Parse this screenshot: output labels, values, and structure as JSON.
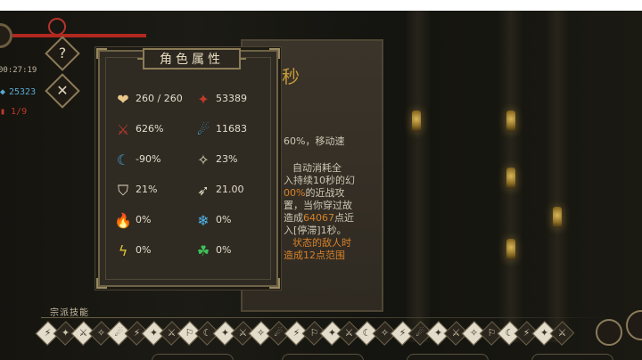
{
  "hud": {
    "timer": "00:27:19",
    "currency": "25323",
    "counter": "1/9",
    "help_glyph": "?",
    "close_glyph": "✕"
  },
  "attributes_panel": {
    "title": "角色属性",
    "stats": [
      {
        "icon": "heart-icon",
        "glyph": "❤",
        "color": "#e8c98a",
        "value": "260 / 260"
      },
      {
        "icon": "red-blade-icon",
        "glyph": "✦",
        "color": "#c0392b",
        "value": "53389"
      },
      {
        "icon": "red-claw-icon",
        "glyph": "⚔",
        "color": "#c0392b",
        "value": "626%"
      },
      {
        "icon": "blue-scythe-icon",
        "glyph": "☄",
        "color": "#3fa7d6",
        "value": "11683"
      },
      {
        "icon": "blue-crescent-icon",
        "glyph": "☾",
        "color": "#3fa7d6",
        "value": "-90%"
      },
      {
        "icon": "torn-scroll-icon",
        "glyph": "✧",
        "color": "#e8dcc0",
        "value": "23%"
      },
      {
        "icon": "shield-icon",
        "glyph": "⛉",
        "color": "#e8dcc0",
        "value": "21%"
      },
      {
        "icon": "boot-icon",
        "glyph": "➶",
        "color": "#e8dcc0",
        "value": "21.00"
      },
      {
        "icon": "fire-icon",
        "glyph": "🔥",
        "color": "#e06a1f",
        "value": "0%"
      },
      {
        "icon": "frost-icon",
        "glyph": "❄",
        "color": "#4fb3e8",
        "value": "0%"
      },
      {
        "icon": "lightning-icon",
        "glyph": "ϟ",
        "color": "#e0c13a",
        "value": "0%"
      },
      {
        "icon": "poison-icon",
        "glyph": "☘",
        "color": "#3ec25a",
        "value": "0%"
      }
    ]
  },
  "skill_description": {
    "title_glyph": "秒",
    "lines": [
      [
        {
          "t": "60%，移动速",
          "c": ""
        }
      ],
      [
        {
          "t": "自动消耗全",
          "c": ""
        }
      ],
      [
        {
          "t": "入持续10秒的幻",
          "c": ""
        }
      ],
      [
        {
          "t": "00%",
          "c": "orange"
        },
        {
          "t": "的近战攻",
          "c": ""
        }
      ],
      [
        {
          "t": "置，当你穿过故",
          "c": ""
        }
      ],
      [
        {
          "t": "造成",
          "c": ""
        },
        {
          "t": "64067",
          "c": "orange"
        },
        {
          "t": "点近",
          "c": ""
        }
      ],
      [
        {
          "t": "入[停滞]1秒。",
          "c": ""
        }
      ],
      [
        {
          "t": "状态的敌人时",
          "c": "orange"
        }
      ],
      [
        {
          "t": "造成12点范围",
          "c": "orange"
        }
      ]
    ]
  },
  "skill_bar": {
    "label": "宗派技能",
    "skills": [
      "⚡",
      "✦",
      "⚔",
      "✧",
      "☄",
      "⚡",
      "✦",
      "⚔",
      "⚐",
      "☾",
      "✦",
      "⚔",
      "✧",
      "☄",
      "⚡",
      "⚐",
      "✦",
      "⚔",
      "☾",
      "✧",
      "⚡",
      "☄",
      "✦",
      "⚔",
      "✧",
      "⚐",
      "☾",
      "⚡",
      "✦",
      "⚔"
    ]
  },
  "colors": {
    "panel_bg": "#2f2b23",
    "panel_border": "#6e6346",
    "text_light": "#e4dccb",
    "accent_orange": "#d7822a",
    "hud_blue": "#58a8d0",
    "hud_red": "#c0392b"
  }
}
